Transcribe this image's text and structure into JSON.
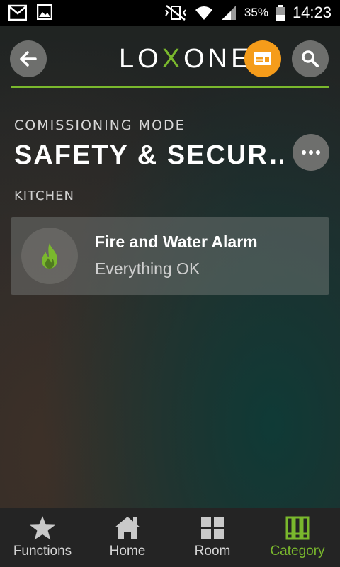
{
  "status_bar": {
    "battery": "35%",
    "time": "14:23",
    "icons": [
      "gmail-icon",
      "gallery-icon",
      "vibrate-mute-icon",
      "wifi-icon",
      "signal-icon",
      "battery-icon"
    ]
  },
  "header": {
    "logo": {
      "pre": "LO",
      "x": "X",
      "post": "ONE"
    },
    "accent_color": "#7ab82d",
    "notify_color": "#f59c1a"
  },
  "page": {
    "mode": "COMISSIONING MODE",
    "title": "SAFETY & SECUR…"
  },
  "room": {
    "label": "KITCHEN",
    "items": [
      {
        "title": "Fire and Water Alarm",
        "status": "Everything OK",
        "icon": "flame-icon"
      }
    ]
  },
  "tabs": [
    {
      "label": "Functions",
      "icon": "star-icon",
      "active": false
    },
    {
      "label": "Home",
      "icon": "home-icon",
      "active": false
    },
    {
      "label": "Room",
      "icon": "grid-icon",
      "active": false
    },
    {
      "label": "Category",
      "icon": "category-icon",
      "active": true
    }
  ]
}
